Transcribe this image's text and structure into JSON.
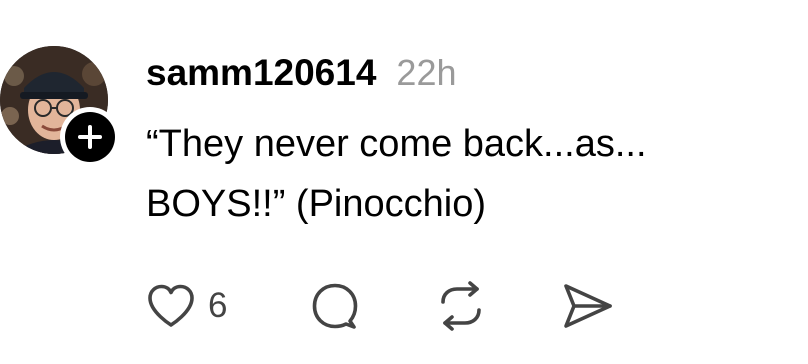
{
  "post": {
    "username": "samm120614",
    "time": "22h",
    "text_lines": [
      "“They never come back...as...",
      "BOYS!!” (Pinocchio)"
    ],
    "like_count": "6"
  },
  "icons": {
    "follow": "plus-icon",
    "like": "heart-icon",
    "reply": "speech-bubble-icon",
    "repost": "repost-arrows-icon",
    "share": "send-icon"
  },
  "colors": {
    "text": "#000000",
    "muted": "#9a9a9a",
    "icon": "#444444",
    "badge": "#000000"
  }
}
